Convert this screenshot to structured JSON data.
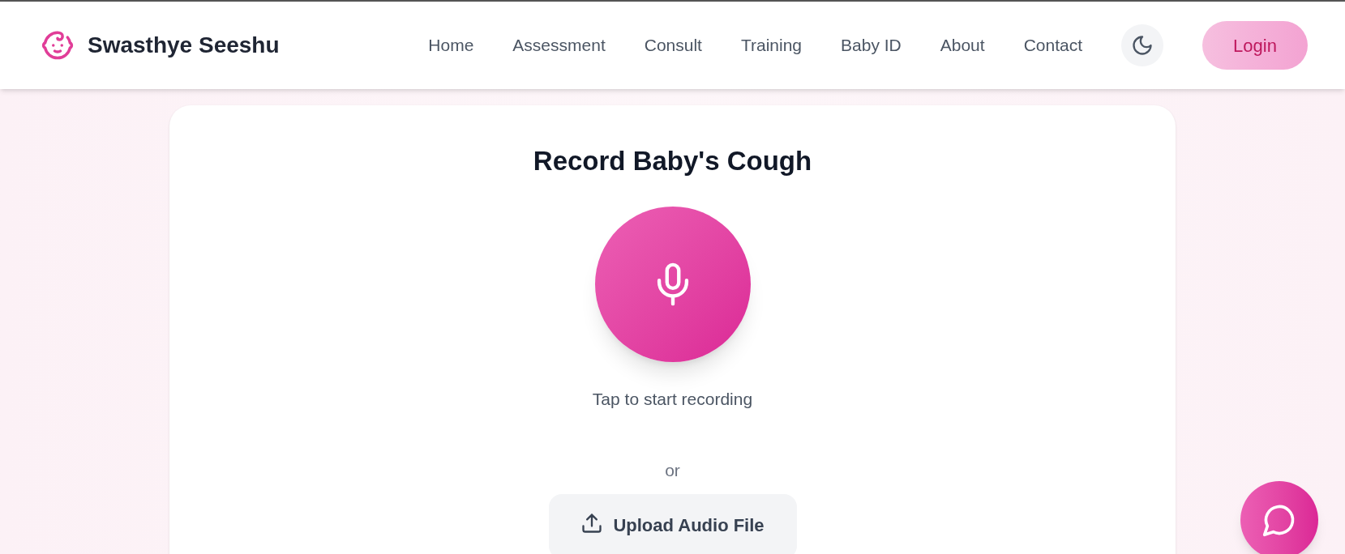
{
  "brand": {
    "name": "Swasthye Seeshu"
  },
  "nav": [
    {
      "label": "Home"
    },
    {
      "label": "Assessment"
    },
    {
      "label": "Consult"
    },
    {
      "label": "Training"
    },
    {
      "label": "Baby ID"
    },
    {
      "label": "About"
    },
    {
      "label": "Contact"
    }
  ],
  "login": {
    "label": "Login"
  },
  "recorder": {
    "title": "Record Baby's Cough",
    "hint": "Tap to start recording",
    "separator": "or",
    "upload": "Upload Audio File"
  }
}
